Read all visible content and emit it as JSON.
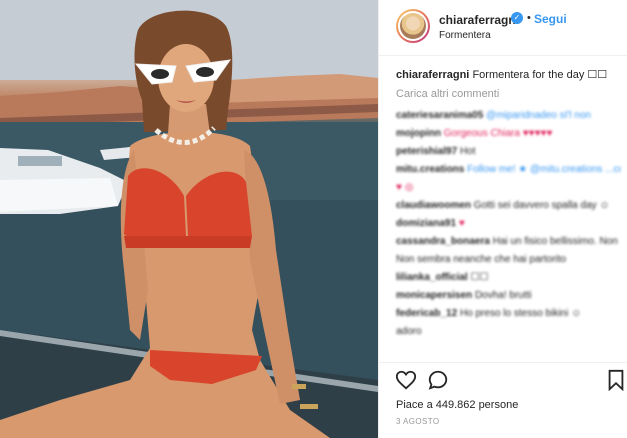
{
  "post": {
    "username": "chiaraferragni",
    "verified_mark": "✓",
    "separator": "•",
    "follow_label": "Segui",
    "location": "Formentera",
    "caption_user": "chiaraferragni",
    "caption_text": "Formentera for the day ☐☐",
    "load_more_label": "Carica altri commenti",
    "likes_label": "Piace a 449.862 persone",
    "date_label": "3 AGOSTO"
  },
  "comments": [
    {
      "user": "cateriesaranima05",
      "text": "@miparidnadeo sI'l non",
      "accent": "blue"
    },
    {
      "user": "mojopinn",
      "text": "Gorgeous Chiara ♥♥♥♥♥",
      "accent": "red"
    },
    {
      "user": "peterishial97",
      "text": "Hot",
      "accent": ""
    },
    {
      "user": "mitu.creations",
      "text": "Follow me! ★ @mitu.creations ...consiglie a molto altro..",
      "accent": "blue"
    },
    {
      "user": "",
      "text": "♥ ◎",
      "accent": "red"
    },
    {
      "user": "claudiawoomen",
      "text": "Gotti sei davvero spalla day ☺",
      "accent": ""
    },
    {
      "user": "domiziana91",
      "text": "♥",
      "accent": "red"
    },
    {
      "user": "cassandra_bonaera",
      "text": "Hai un fisico bellissimo. Non sembra neanche che hai partorito",
      "accent": ""
    },
    {
      "user": "",
      "text": "Non sembra neanche che hai partorito",
      "accent": ""
    },
    {
      "user": "lilianka_official",
      "text": "☐☐",
      "accent": ""
    },
    {
      "user": "monicapersisen",
      "text": "Dovha! brutti",
      "accent": ""
    },
    {
      "user": "federicab_12",
      "text": "Ho preso lo stesso bikini ☺",
      "accent": ""
    },
    {
      "user": "",
      "text": "adoro",
      "accent": ""
    }
  ],
  "icons": {
    "like": "heart-icon",
    "comment": "comment-icon",
    "save": "bookmark-icon"
  },
  "colors": {
    "link_blue": "#3897f0",
    "text": "#262626",
    "muted": "#999999"
  }
}
